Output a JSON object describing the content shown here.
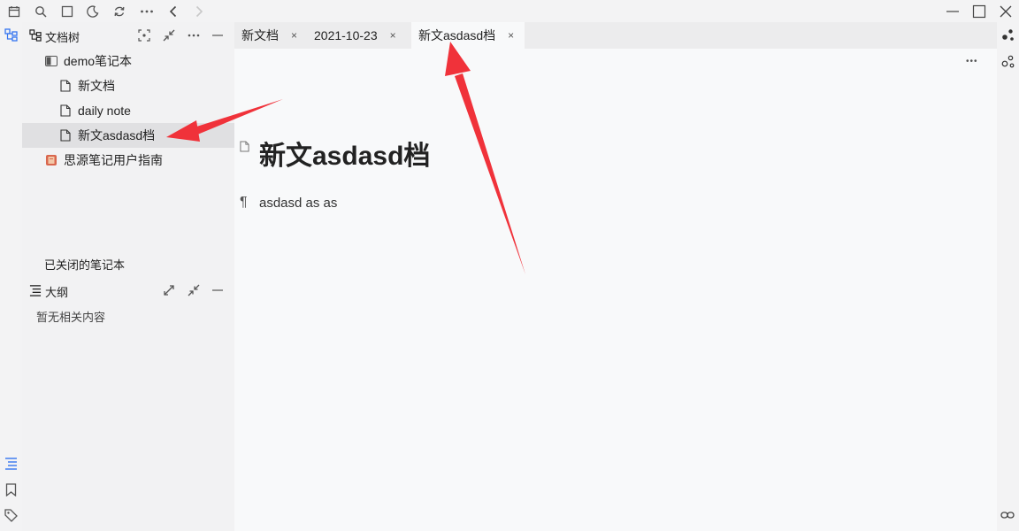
{
  "tree": {
    "title": "文档树",
    "notebook": "demo笔记本",
    "docs": [
      "新文档",
      "daily note",
      "新文asdasd档"
    ],
    "guide": "思源笔记用户指南",
    "closed_notebooks": "已关闭的笔记本"
  },
  "outline": {
    "title": "大纲",
    "empty": "暂无相关内容"
  },
  "tabs": [
    {
      "label": "新文档",
      "close": "×"
    },
    {
      "label": "2021-10-23",
      "close": "×"
    },
    {
      "label": "新文asdasd档",
      "close": "×"
    }
  ],
  "editor": {
    "title": "新文asdasd档",
    "paragraph_marker": "¶",
    "paragraph": "asdasd as as",
    "more": "•••"
  },
  "colors": {
    "accent": "#3575f0",
    "arrow": "#f0323a"
  }
}
